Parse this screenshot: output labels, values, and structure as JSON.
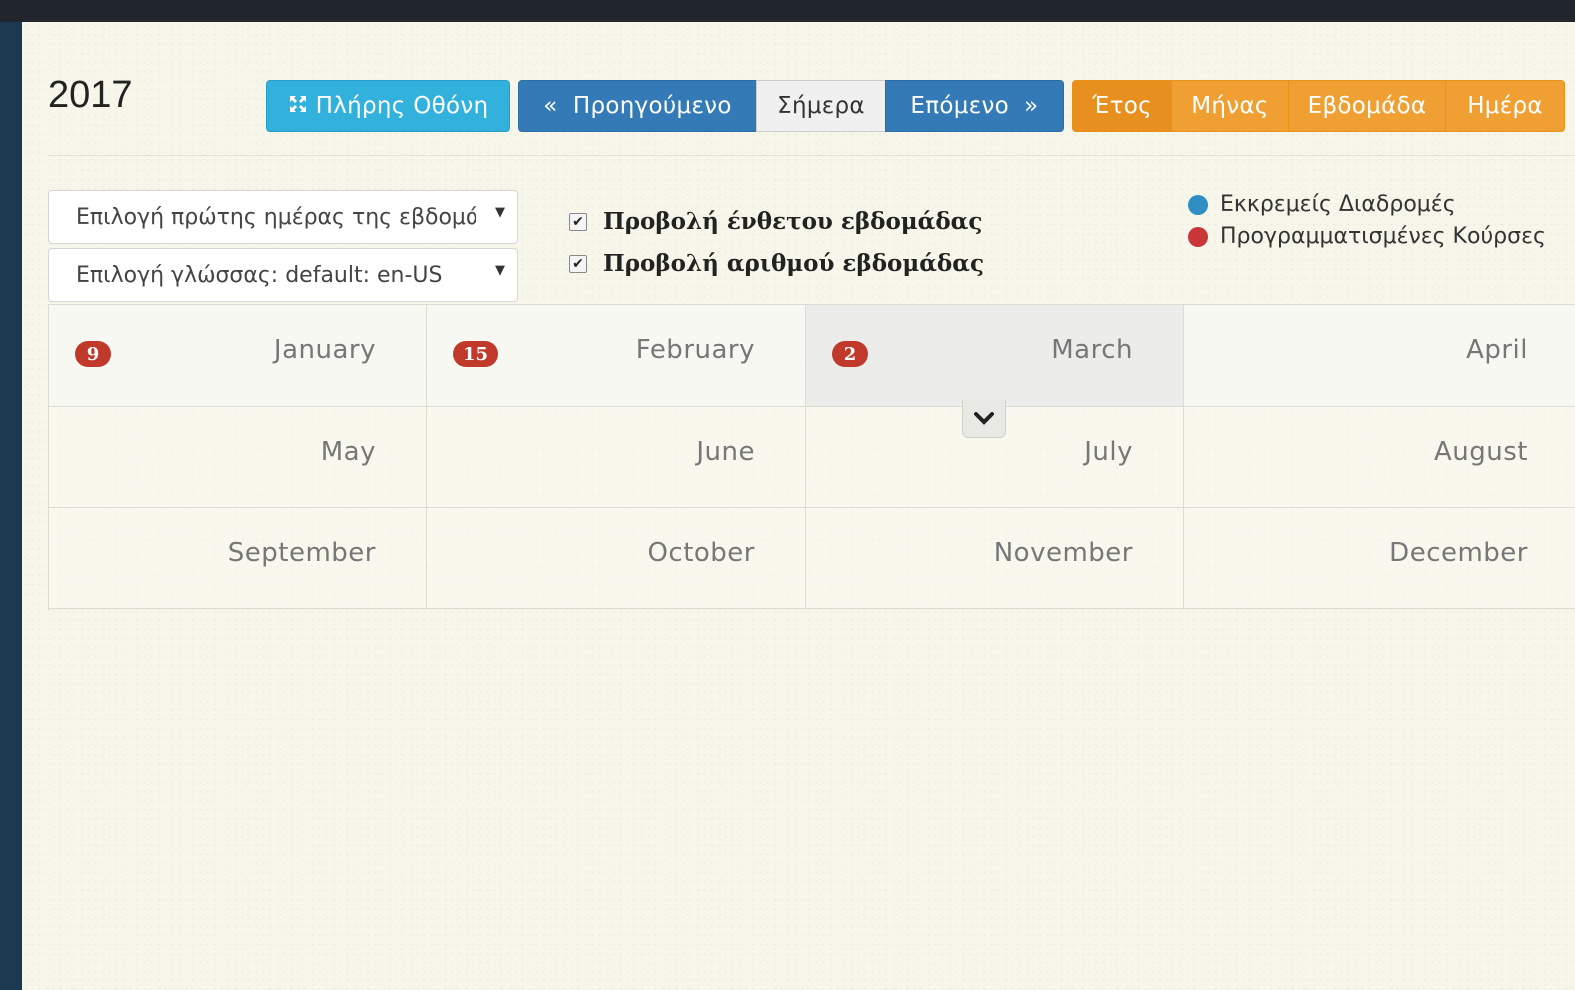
{
  "header": {
    "year": "2017"
  },
  "toolbar": {
    "fullscreen": {
      "label": "Πλήρης Οθόνη",
      "icon": "fullscreen-icon"
    },
    "nav": {
      "prev": "«  Προηγούμενο",
      "today": "Σήμερα",
      "next": "Επόμενο  »"
    },
    "views": [
      {
        "label": "Έτος",
        "active": true
      },
      {
        "label": "Μήνας",
        "active": false
      },
      {
        "label": "Εβδομάδα",
        "active": false
      },
      {
        "label": "Ημέρα",
        "active": false
      }
    ]
  },
  "options": {
    "first_day_select": "Επιλογή πρώτης ημέρας της εβδομάδας",
    "language_select": "Επιλογή γλώσσας: default: en-US",
    "show_week_box": "Προβολή ένθετου εβδομάδας",
    "show_week_number": "Προβολή αριθμού εβδομάδας",
    "checkmark": "✔"
  },
  "legend": [
    {
      "label": "Εκκρεμείς Διαδρομές",
      "color": "#2f8fc4"
    },
    {
      "label": "Προγραμματισμένες Κούρσες",
      "color": "#c9363a"
    }
  ],
  "calendar": {
    "months": [
      {
        "name": "January",
        "count": "9"
      },
      {
        "name": "February",
        "count": "15"
      },
      {
        "name": "March",
        "count": "2",
        "selected": true
      },
      {
        "name": "April",
        "count": ""
      },
      {
        "name": "May",
        "count": ""
      },
      {
        "name": "June",
        "count": ""
      },
      {
        "name": "July",
        "count": ""
      },
      {
        "name": "August",
        "count": ""
      },
      {
        "name": "September",
        "count": ""
      },
      {
        "name": "October",
        "count": ""
      },
      {
        "name": "November",
        "count": ""
      },
      {
        "name": "December",
        "count": ""
      }
    ],
    "toggle_icon": "chevron-down-icon"
  }
}
